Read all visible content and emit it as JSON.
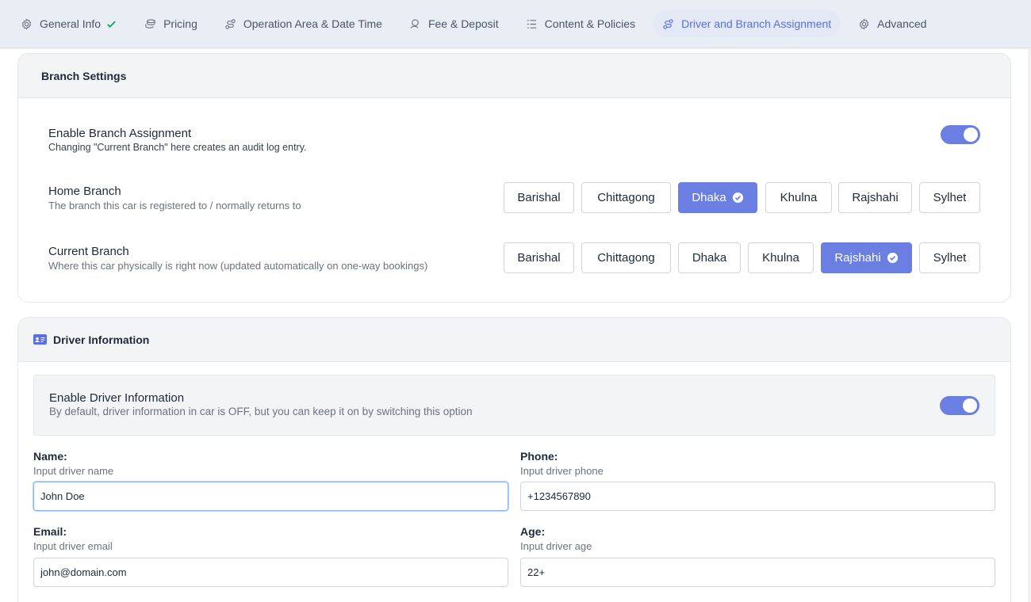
{
  "tabs": [
    {
      "label": "General Info",
      "icon": "gear-icon"
    },
    {
      "label": "Pricing",
      "icon": "coins-icon"
    },
    {
      "label": "Operation Area & Date Time",
      "icon": "route-icon"
    },
    {
      "label": "Fee & Deposit",
      "icon": "money-hand-icon"
    },
    {
      "label": "Content & Policies",
      "icon": "list-icon"
    },
    {
      "label": "Driver and Branch Assignment",
      "icon": "route-icon"
    },
    {
      "label": "Advanced",
      "icon": "gear-icon"
    }
  ],
  "branch": {
    "title": "Branch Settings",
    "enable": {
      "label": "Enable Branch Assignment",
      "sub": "Changing \"Current Branch\" here creates an audit log entry.",
      "on": true
    },
    "home": {
      "label": "Home Branch",
      "sub": "The branch this car is registered to / normally returns to",
      "options": [
        "Barishal",
        "Chittagong",
        "Dhaka",
        "Khulna",
        "Rajshahi",
        "Sylhet"
      ],
      "selected": "Dhaka"
    },
    "current": {
      "label": "Current Branch",
      "sub": "Where this car physically is right now (updated automatically on one-way bookings)",
      "options": [
        "Barishal",
        "Chittagong",
        "Dhaka",
        "Khulna",
        "Rajshahi",
        "Sylhet"
      ],
      "selected": "Rajshahi"
    }
  },
  "driver": {
    "title": "Driver Information",
    "enable": {
      "label": "Enable Driver Information",
      "sub": "By default, driver information in car is OFF, but you can keep it on by switching this option",
      "on": true
    },
    "name": {
      "label": "Name:",
      "sub": "Input driver name",
      "value": "John Doe"
    },
    "phone": {
      "label": "Phone:",
      "sub": "Input driver phone",
      "value": "+1234567890"
    },
    "email": {
      "label": "Email:",
      "sub": "Input driver email",
      "value": "john@domain.com"
    },
    "age": {
      "label": "Age:",
      "sub": "Input driver age",
      "value": "22+"
    }
  },
  "colors": {
    "accent": "#6b7fe3",
    "success": "#22a06b"
  }
}
